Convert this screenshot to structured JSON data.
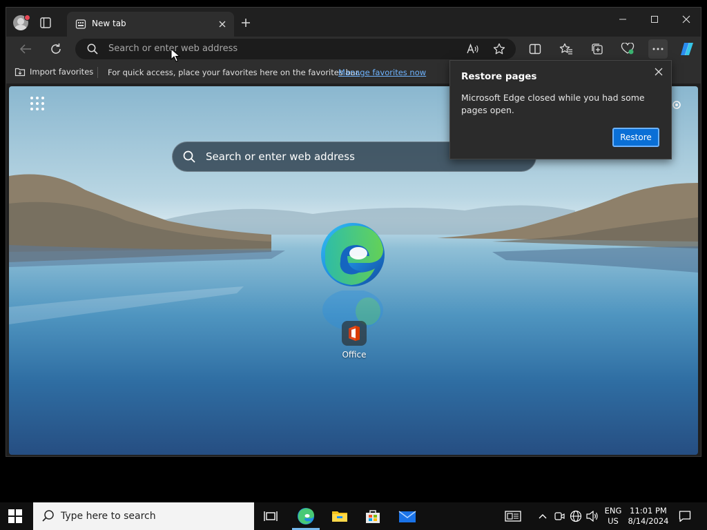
{
  "tab": {
    "title": "New tab"
  },
  "address_bar": {
    "placeholder": "Search or enter web address"
  },
  "favorites_bar": {
    "import_label": "Import favorites",
    "message": "For quick access, place your favorites here on the favorites bar.",
    "manage_link": "Manage favorites now"
  },
  "ntp": {
    "search_placeholder": "Search or enter web address",
    "shortcut_label": "Office"
  },
  "popup": {
    "title": "Restore pages",
    "body": "Microsoft Edge closed while you had some pages open.",
    "button": "Restore"
  },
  "taskbar": {
    "search_placeholder": "Type here to search",
    "lang_line1": "ENG",
    "lang_line2": "US",
    "time": "11:01 PM",
    "date": "8/14/2024"
  },
  "colors": {
    "accent": "#0a6fd6",
    "link": "#6fb4ff",
    "chrome_bg": "#202020",
    "toolbar_bg": "#2e2e2e"
  }
}
